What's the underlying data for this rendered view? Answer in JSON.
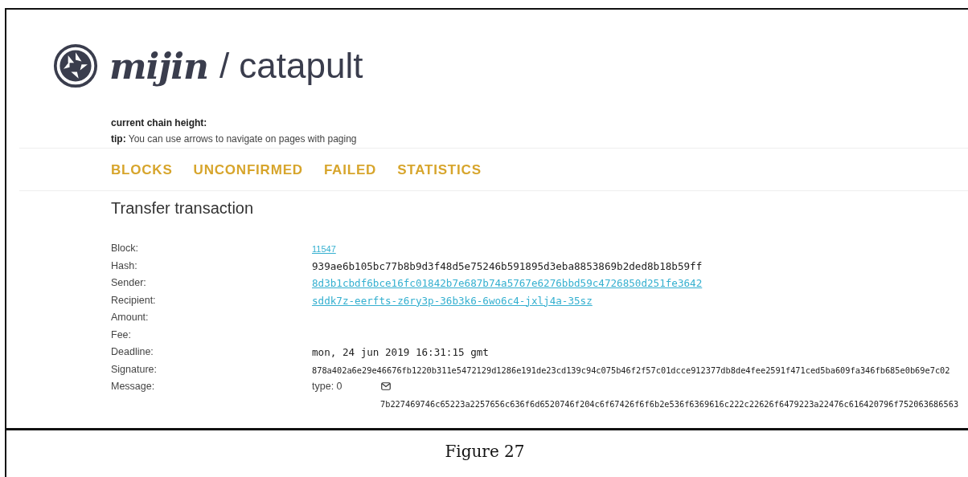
{
  "header": {
    "brand": "mijin",
    "product": "/ catapult"
  },
  "info": {
    "chain_height_label": "current chain height:",
    "tip_label": "tip:",
    "tip_text": "You can use arrows to navigate on pages with paging"
  },
  "nav": [
    {
      "label": "BLOCKS"
    },
    {
      "label": "UNCONFIRMED"
    },
    {
      "label": "FAILED"
    },
    {
      "label": "STATISTICS"
    }
  ],
  "title": "Transfer transaction",
  "fields": [
    {
      "label": "Block:",
      "kind": "small-link",
      "value": "11547"
    },
    {
      "label": "Hash:",
      "kind": "mono",
      "value": "939ae6b105bc77b8b9d3f48d5e75246b591895d3eba8853869b2ded8b18b59ff"
    },
    {
      "label": "Sender:",
      "kind": "link",
      "value": "8d3b1cbdf6bce16fc01842b7e687b74a5767e6276bbd59c4726850d251fe3642"
    },
    {
      "label": "Recipient:",
      "kind": "link",
      "value": "sddk7z-eerfts-z6ry3p-36b3k6-6wo6c4-jxlj4a-35sz"
    },
    {
      "label": "Amount:",
      "kind": "empty"
    },
    {
      "label": "Fee:",
      "kind": "empty"
    },
    {
      "label": "Deadline:",
      "kind": "mono",
      "value": "mon, 24 jun 2019 16:31:15 gmt"
    },
    {
      "label": "Signature:",
      "kind": "small-mono",
      "value": "878a402a6e29e46676fb1220b311e5472129d1286e191de23cd139c94c075b46f2f57c01dcce912377db8de4fee2591f471ced5ba609fa346fb685e0b69e7c02"
    },
    {
      "label": "Message:",
      "kind": "message",
      "type": "type: 0",
      "value": "7b227469746c65223a2257656c636f6d6520746f204c6f67426f6f6b2e536f6369616c222c22626f6479223a22476c616420796f752063686563"
    }
  ],
  "caption": "Figure 27"
}
